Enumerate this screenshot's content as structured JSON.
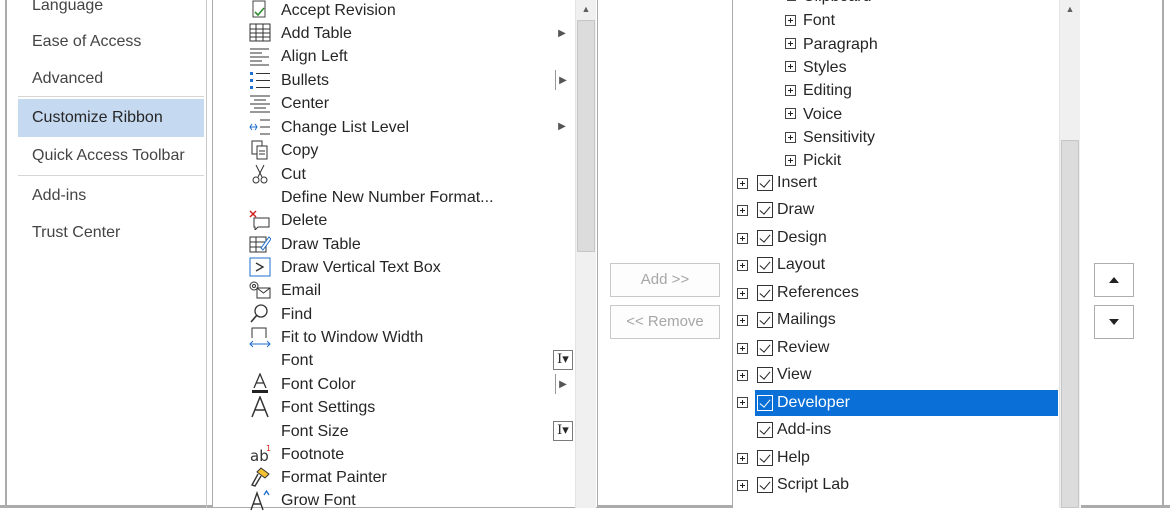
{
  "nav": {
    "items": [
      {
        "label": "Language"
      },
      {
        "label": "Ease of Access"
      },
      {
        "label": "Advanced"
      },
      {
        "label": "Customize Ribbon"
      },
      {
        "label": "Quick Access Toolbar"
      },
      {
        "label": "Add-ins"
      },
      {
        "label": "Trust Center"
      }
    ],
    "selected": "Customize Ribbon"
  },
  "commands": [
    {
      "label": "Accept Revision",
      "icon": "accept-revision-icon"
    },
    {
      "label": "Add Table",
      "icon": "table-grid-icon",
      "submenu": true
    },
    {
      "label": "Align Left",
      "icon": "align-left-icon"
    },
    {
      "label": "Bullets",
      "icon": "bullets-icon",
      "split": true
    },
    {
      "label": "Center",
      "icon": "align-center-icon"
    },
    {
      "label": "Change List Level",
      "icon": "change-list-level-icon",
      "submenu": true
    },
    {
      "label": "Copy",
      "icon": "copy-icon"
    },
    {
      "label": "Cut",
      "icon": "scissors-icon"
    },
    {
      "label": "Define New Number Format...",
      "icon": ""
    },
    {
      "label": "Delete",
      "icon": "delete-comment-icon"
    },
    {
      "label": "Draw Table",
      "icon": "draw-table-icon"
    },
    {
      "label": "Draw Vertical Text Box",
      "icon": "vertical-text-box-icon"
    },
    {
      "label": "Email",
      "icon": "email-icon"
    },
    {
      "label": "Find",
      "icon": "magnifier-icon"
    },
    {
      "label": "Fit to Window Width",
      "icon": "fit-width-icon"
    },
    {
      "label": "Font",
      "icon": "",
      "ibeam": true
    },
    {
      "label": "Font Color",
      "icon": "font-color-icon",
      "split": true
    },
    {
      "label": "Font Settings",
      "icon": "font-settings-icon"
    },
    {
      "label": "Font Size",
      "icon": "",
      "ibeam": true
    },
    {
      "label": "Footnote",
      "icon": "footnote-icon"
    },
    {
      "label": "Format Painter",
      "icon": "format-painter-icon"
    },
    {
      "label": "Grow Font",
      "icon": "grow-font-icon"
    }
  ],
  "buttons": {
    "add_label": "Add >>",
    "remove_label": "<< Remove"
  },
  "tree": {
    "groups": [
      {
        "label": "Clipboard"
      },
      {
        "label": "Font"
      },
      {
        "label": "Paragraph"
      },
      {
        "label": "Styles"
      },
      {
        "label": "Editing"
      },
      {
        "label": "Voice"
      },
      {
        "label": "Sensitivity"
      },
      {
        "label": "Pickit"
      }
    ],
    "tabs": [
      {
        "label": "Insert",
        "checked": true,
        "expandable": true
      },
      {
        "label": "Draw",
        "checked": true,
        "expandable": true
      },
      {
        "label": "Design",
        "checked": true,
        "expandable": true
      },
      {
        "label": "Layout",
        "checked": true,
        "expandable": true
      },
      {
        "label": "References",
        "checked": true,
        "expandable": true
      },
      {
        "label": "Mailings",
        "checked": true,
        "expandable": true
      },
      {
        "label": "Review",
        "checked": true,
        "expandable": true
      },
      {
        "label": "View",
        "checked": true,
        "expandable": true
      },
      {
        "label": "Developer",
        "checked": true,
        "expandable": true,
        "selected": true
      },
      {
        "label": "Add-ins",
        "checked": true,
        "expandable": false
      },
      {
        "label": "Help",
        "checked": true,
        "expandable": true
      },
      {
        "label": "Script Lab",
        "checked": true,
        "expandable": true
      }
    ]
  },
  "move": {
    "up_icon": "move-up-triangle-icon",
    "down_icon": "move-down-triangle-icon"
  },
  "colors": {
    "selection": "#0a6fd6",
    "nav_selected": "#c5d9f1"
  }
}
